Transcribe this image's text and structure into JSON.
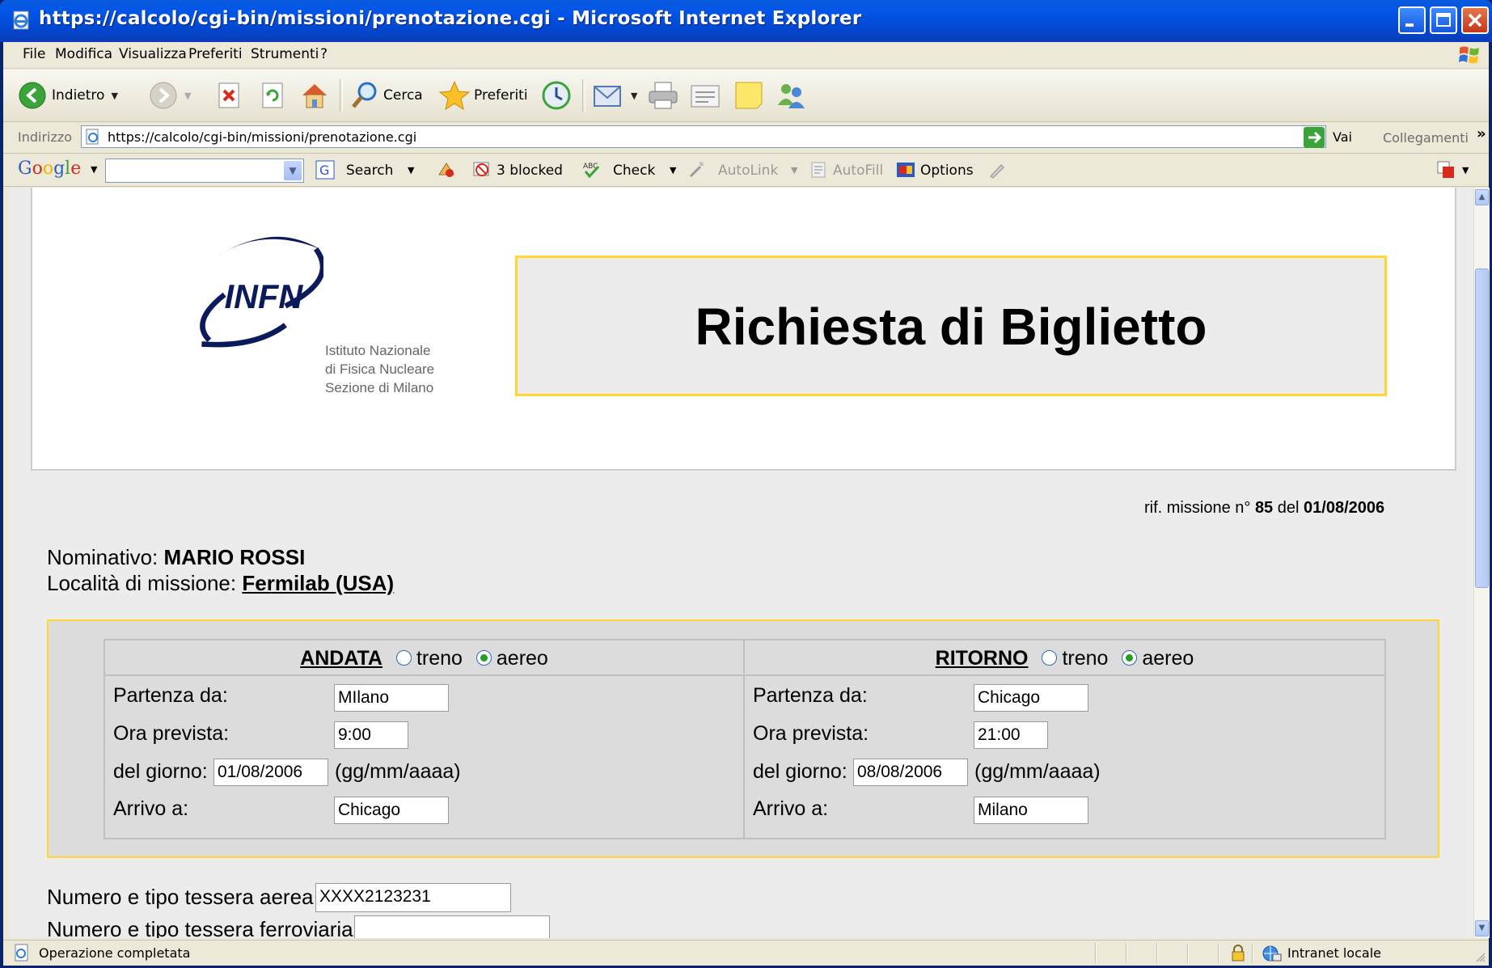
{
  "window": {
    "title": "https://calcolo/cgi-bin/missioni/prenotazione.cgi - Microsoft Internet Explorer"
  },
  "menu": [
    "File",
    "Modifica",
    "Visualizza",
    "Preferiti",
    "Strumenti",
    "?"
  ],
  "toolbar": {
    "back_label": "Indietro",
    "search_label": "Cerca",
    "favorites_label": "Preferiti"
  },
  "address": {
    "label": "Indirizzo",
    "url": "https://calcolo/cgi-bin/missioni/prenotazione.cgi",
    "go_label": "Vai",
    "links_label": "Collegamenti"
  },
  "googlebar": {
    "logo": "Google",
    "search_label": "Search",
    "blocked_label": "3 blocked",
    "check_label": "Check",
    "autolink_label": "AutoLink",
    "autofill_label": "AutoFill",
    "options_label": "Options"
  },
  "page": {
    "org_lines": [
      "Istituto Nazionale",
      "di Fisica Nucleare",
      "Sezione di Milano"
    ],
    "logo_text": "INFN",
    "title": "Richiesta di Biglietto",
    "rif_prefix": "rif. missione n°",
    "rif_number": "85",
    "rif_mid": "del",
    "rif_date": "01/08/2006",
    "nominativo_label": "Nominativo:",
    "nominativo": "MARIO ROSSI",
    "localita_label": "Località di missione:",
    "localita": "Fermilab (USA)",
    "andata": {
      "label": "ANDATA",
      "opt_train": "treno",
      "opt_plane": "aereo",
      "selected": "aereo",
      "partenza_label": "Partenza da:",
      "partenza": "MIlano",
      "ora_label": "Ora prevista:",
      "ora": "9:00",
      "giorno_label": "del giorno:",
      "giorno": "01/08/2006",
      "giorno_hint": "(gg/mm/aaaa)",
      "arrivo_label": "Arrivo a:",
      "arrivo": "Chicago"
    },
    "ritorno": {
      "label": "RITORNO",
      "opt_train": "treno",
      "opt_plane": "aereo",
      "selected": "aereo",
      "partenza_label": "Partenza da:",
      "partenza": "Chicago",
      "ora_label": "Ora prevista:",
      "ora": "21:00",
      "giorno_label": "del giorno:",
      "giorno": "08/08/2006",
      "giorno_hint": "(gg/mm/aaaa)",
      "arrivo_label": "Arrivo a:",
      "arrivo": "Milano"
    },
    "tessera_aerea_label": "Numero e tipo tessera aerea",
    "tessera_aerea": "XXXX2123231",
    "tessera_ferroviaria_label": "Numero e tipo tessera ferroviaria",
    "tessera_ferroviaria": ""
  },
  "status": {
    "text": "Operazione completata",
    "zone": "Intranet locale"
  }
}
